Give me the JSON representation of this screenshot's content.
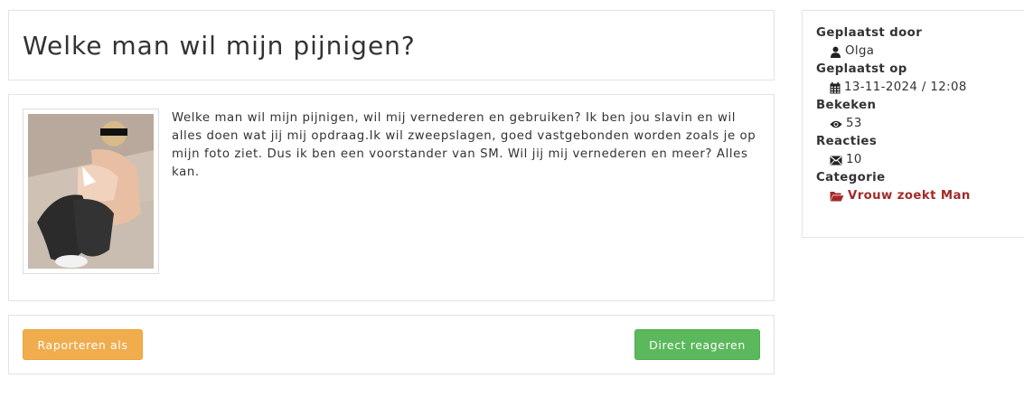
{
  "post": {
    "title": "Welke man wil mijn pijnigen?",
    "body": "Welke man wil mijn pijnigen, wil mij vernederen en gebruiken? Ik ben jou slavin en wil alles doen wat jij mij opdraag.Ik wil zweepslagen, goed vastgebonden worden zoals je op mijn foto ziet. Dus ik ben een voorstander van SM. Wil jij mij vernederen en meer? Alles kan."
  },
  "actions": {
    "report_label": "Raporteren als",
    "reply_label": "Direct reageren"
  },
  "sidebar": {
    "posted_by_label": "Geplaatst door",
    "posted_by_value": "Olga",
    "posted_by_icon": "user-icon",
    "posted_on_label": "Geplaatst op",
    "posted_on_value": "13-11-2024 / 12:08",
    "posted_on_icon": "calendar-icon",
    "views_label": "Bekeken",
    "views_value": "53",
    "views_icon": "eye-icon",
    "replies_label": "Reacties",
    "replies_value": "10",
    "replies_icon": "envelope-icon",
    "category_label": "Categorie",
    "category_value": "Vrouw zoekt Man",
    "category_icon": "folder-open-icon"
  },
  "colors": {
    "warning": "#f0ad4e",
    "success": "#5cb85c",
    "category_link": "#a32a2a",
    "border": "#e3e3e3"
  }
}
